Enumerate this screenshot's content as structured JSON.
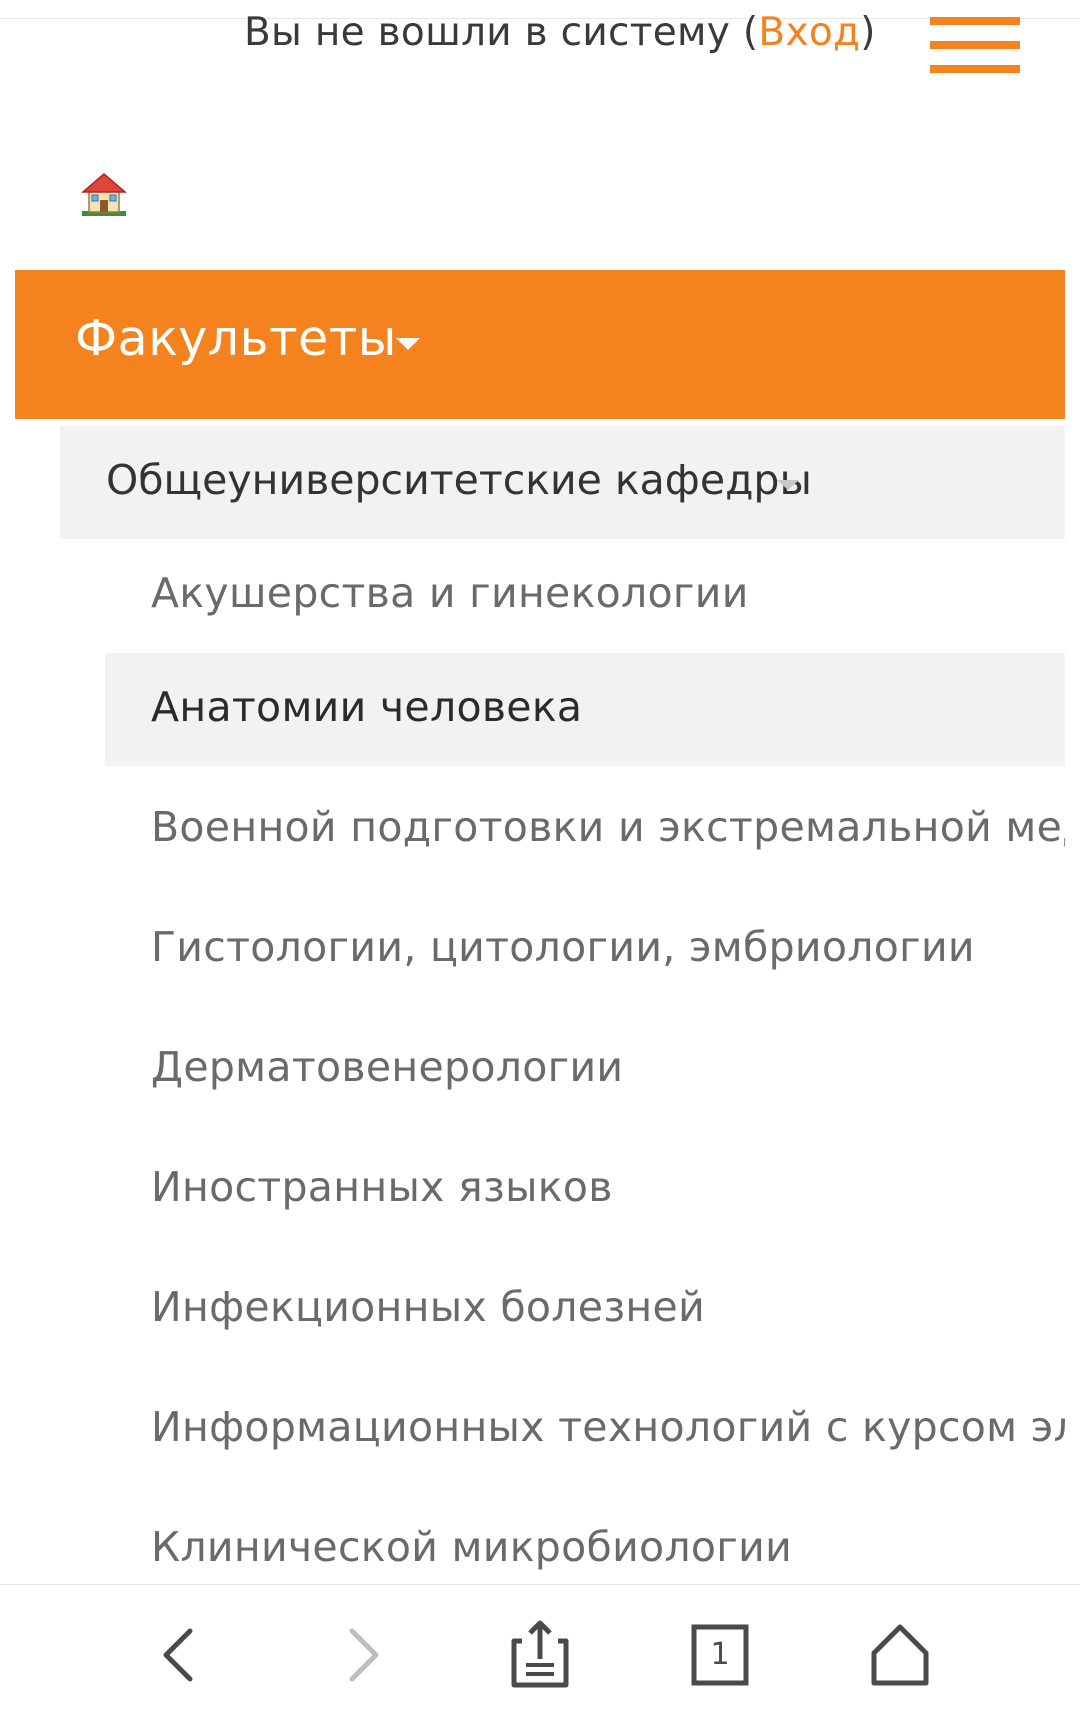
{
  "header": {
    "login_prefix": "Вы не вошли в систему (",
    "login_link": "Вход",
    "login_suffix": ")",
    "menu_icon": "hamburger-icon",
    "home_icon": "house-icon"
  },
  "nav": {
    "faculties_label": "Факультеты",
    "section_label": "Общеуниверситетские кафедры",
    "departments": [
      {
        "label": "Акушерства и гинекологии",
        "active": false
      },
      {
        "label": "Анатомии человека",
        "active": true
      },
      {
        "label": "Военной подготовки и экстремальной медицины",
        "active": false
      },
      {
        "label": "Гистологии, цитологии, эмбриологии",
        "active": false
      },
      {
        "label": "Дерматовенерологии",
        "active": false
      },
      {
        "label": "Иностранных языков",
        "active": false
      },
      {
        "label": "Инфекционных болезней",
        "active": false
      },
      {
        "label": "Информационных технологий с курсом электронного",
        "active": false
      },
      {
        "label": "Клинической микробиологии",
        "active": false
      }
    ]
  },
  "browser_bar": {
    "tab_count": "1",
    "icons": [
      "back-icon",
      "forward-icon",
      "share-icon",
      "tabs-icon",
      "home-icon"
    ]
  },
  "colors": {
    "accent": "#f4831f",
    "active_bg": "#f2f2f2",
    "text_dark": "#333333",
    "text_muted": "#6a6a6a"
  }
}
